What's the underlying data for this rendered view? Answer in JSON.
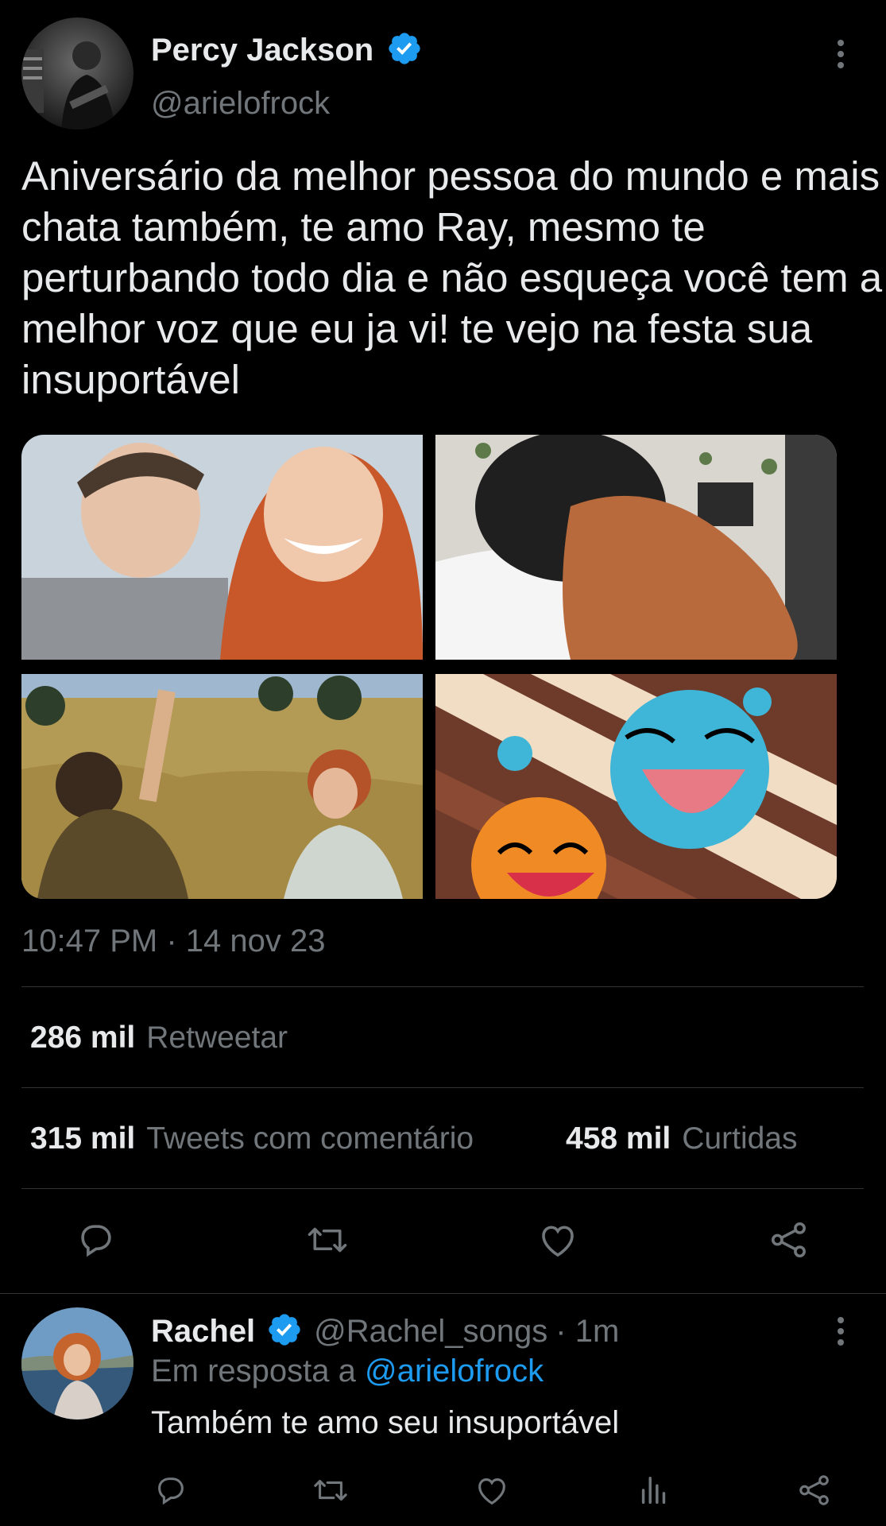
{
  "tweet": {
    "author_name": "Percy Jackson",
    "author_handle": "@arielofrock",
    "text": "Aniversário da melhor pessoa do mundo e mais chata também, te amo Ray, mesmo te perturbando todo dia e não esqueça você tem a melhor voz que eu ja vi! te vejo na festa sua insuportável",
    "timestamp": "10:47 PM · 14 nov 23",
    "retweets_count": "286 mil",
    "retweets_label": "Retweetar",
    "quotes_count": "315 mil",
    "quotes_label": "Tweets com comentário",
    "likes_count": "458 mil",
    "likes_label": "Curtidas"
  },
  "reply": {
    "author_name": "Rachel",
    "author_handle": "@Rachel_songs",
    "time_ago": "· 1m",
    "replying_prefix": "Em resposta a",
    "replying_handle": "@arielofrock",
    "text": "Também te amo seu insuportável"
  },
  "colors": {
    "background": "#000000",
    "text": "#e7e9ea",
    "muted": "#71767b",
    "accent": "#1d9bf0",
    "divider": "#2f3336"
  },
  "icons": [
    "more-icon",
    "verified-badge-icon",
    "reply-icon",
    "retweet-icon",
    "like-icon",
    "share-icon",
    "views-icon"
  ]
}
